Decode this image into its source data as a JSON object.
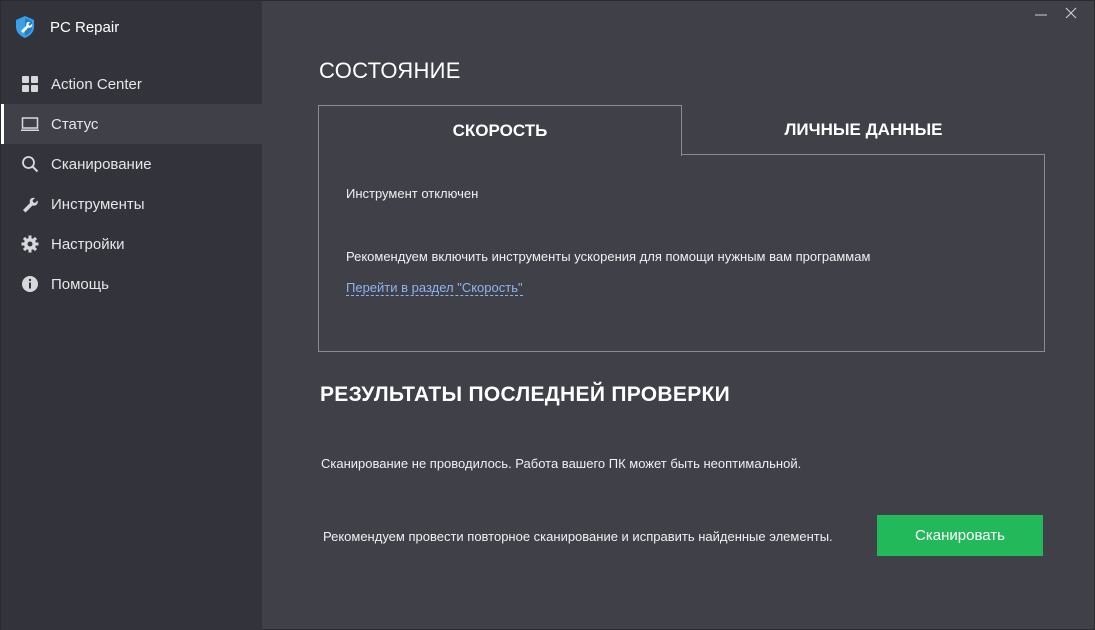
{
  "app": {
    "title": "PC Repair",
    "logo_icon": "wrench-shield-logo-icon",
    "accent_color": "#22b95a",
    "link_color": "#8fb4f0"
  },
  "window_controls": {
    "minimize_icon": "minimize-icon",
    "close_icon": "close-icon"
  },
  "sidebar": {
    "items": [
      {
        "label": "Action Center",
        "icon": "grid-icon",
        "active": false
      },
      {
        "label": "Статус",
        "icon": "monitor-icon",
        "active": true
      },
      {
        "label": "Сканирование",
        "icon": "search-icon",
        "active": false
      },
      {
        "label": "Инструменты",
        "icon": "wrench-icon",
        "active": false
      },
      {
        "label": "Настройки",
        "icon": "gear-icon",
        "active": false
      },
      {
        "label": "Помощь",
        "icon": "info-icon",
        "active": false
      }
    ]
  },
  "status_section": {
    "title": "СОСТОЯНИЕ",
    "tabs": [
      {
        "label": "СКОРОСТЬ",
        "active": true
      },
      {
        "label": "ЛИЧНЫЕ ДАННЫЕ",
        "active": false
      }
    ],
    "panel": {
      "state_text": "Инструмент отключен",
      "recommendation": "Рекомендуем включить инструменты ускорения для помощи нужным вам программам",
      "link_text": "Перейти в раздел \"Скорость\""
    }
  },
  "results_section": {
    "title": "РЕЗУЛЬТАТЫ ПОСЛЕДНЕЙ ПРОВЕРКИ",
    "status_text": "Сканирование не проводилось. Работа вашего ПК может быть неоптимальной.",
    "recommendation": "Рекомендуем провести повторное сканирование и исправить найденные элементы.",
    "scan_button": "Сканировать"
  }
}
